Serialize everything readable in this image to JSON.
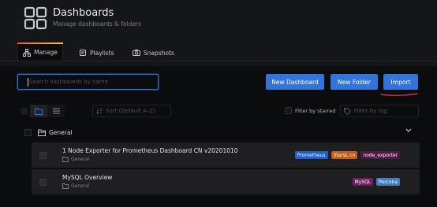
{
  "header": {
    "title": "Dashboards",
    "subtitle": "Manage dashboards & folders",
    "icon": "dashboards-grid-icon"
  },
  "tabs": [
    {
      "label": "Manage",
      "icon": "sitemap-icon",
      "active": true
    },
    {
      "label": "Playlists",
      "icon": "playlist-icon",
      "active": false
    },
    {
      "label": "Snapshots",
      "icon": "camera-icon",
      "active": false
    }
  ],
  "search": {
    "placeholder": "Search dashboards by name",
    "value": ""
  },
  "actions": {
    "new_dashboard": "New Dashboard",
    "new_folder": "New Folder",
    "import": "Import"
  },
  "filters": {
    "sort_placeholder": "Sort (Default A–Z)",
    "starred_label": "Filter by starred",
    "tag_placeholder": "Filter by tag"
  },
  "folder": {
    "name": "General"
  },
  "dashboards": [
    {
      "title": "1 Node Exporter for Prometheus Dashboard CN v20201010",
      "folder": "General",
      "tags": [
        {
          "label": "Prometheus",
          "color": "#1f60c4"
        },
        {
          "label": "StarsL.cn",
          "color": "#c15c17"
        },
        {
          "label": "node_exporter",
          "color": "#511749"
        }
      ]
    },
    {
      "title": "MySQL Overview",
      "folder": "General",
      "tags": [
        {
          "label": "MySQL",
          "color": "#6d1f62"
        },
        {
          "label": "Percona",
          "color": "#447ebc"
        }
      ]
    }
  ],
  "colors": {
    "accent": "#3274d9",
    "background": "#0b0c0e",
    "annotation": "#e02f44"
  }
}
